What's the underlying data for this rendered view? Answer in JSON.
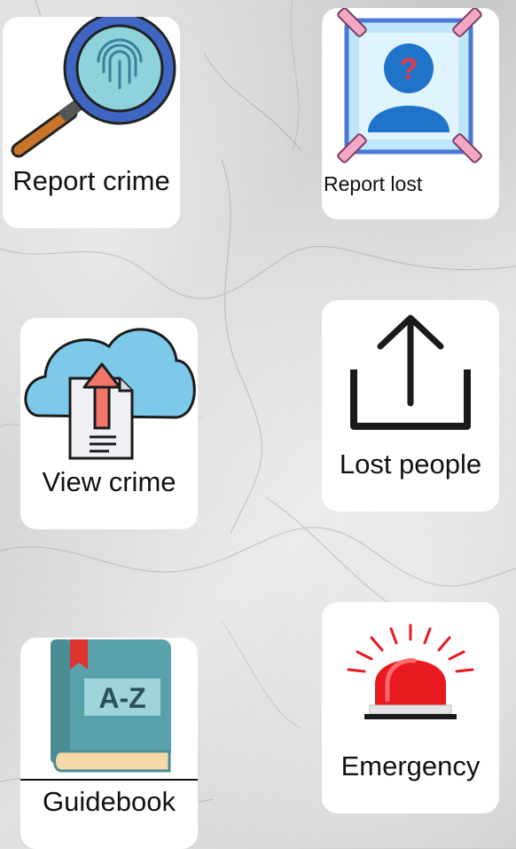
{
  "tiles": [
    {
      "id": "report-crime",
      "label": "Report crime",
      "icon": "magnifier-fingerprint-icon"
    },
    {
      "id": "report-lost",
      "label": "Report lost",
      "icon": "missing-person-icon"
    },
    {
      "id": "view-crime",
      "label": "View crime",
      "icon": "cloud-upload-document-icon"
    },
    {
      "id": "lost-people",
      "label": "Lost people",
      "icon": "share-upload-icon"
    },
    {
      "id": "guidebook",
      "label": "Guidebook",
      "icon": "book-a-z-icon"
    },
    {
      "id": "emergency",
      "label": "Emergency",
      "icon": "siren-icon"
    }
  ],
  "colors": {
    "background": "#d2d2d2",
    "card": "#ffffff",
    "text": "#111111",
    "siren": "#e8191f",
    "book": "#5aa2ab",
    "cloud": "#7dc9ea",
    "arrow": "#f2766a"
  }
}
